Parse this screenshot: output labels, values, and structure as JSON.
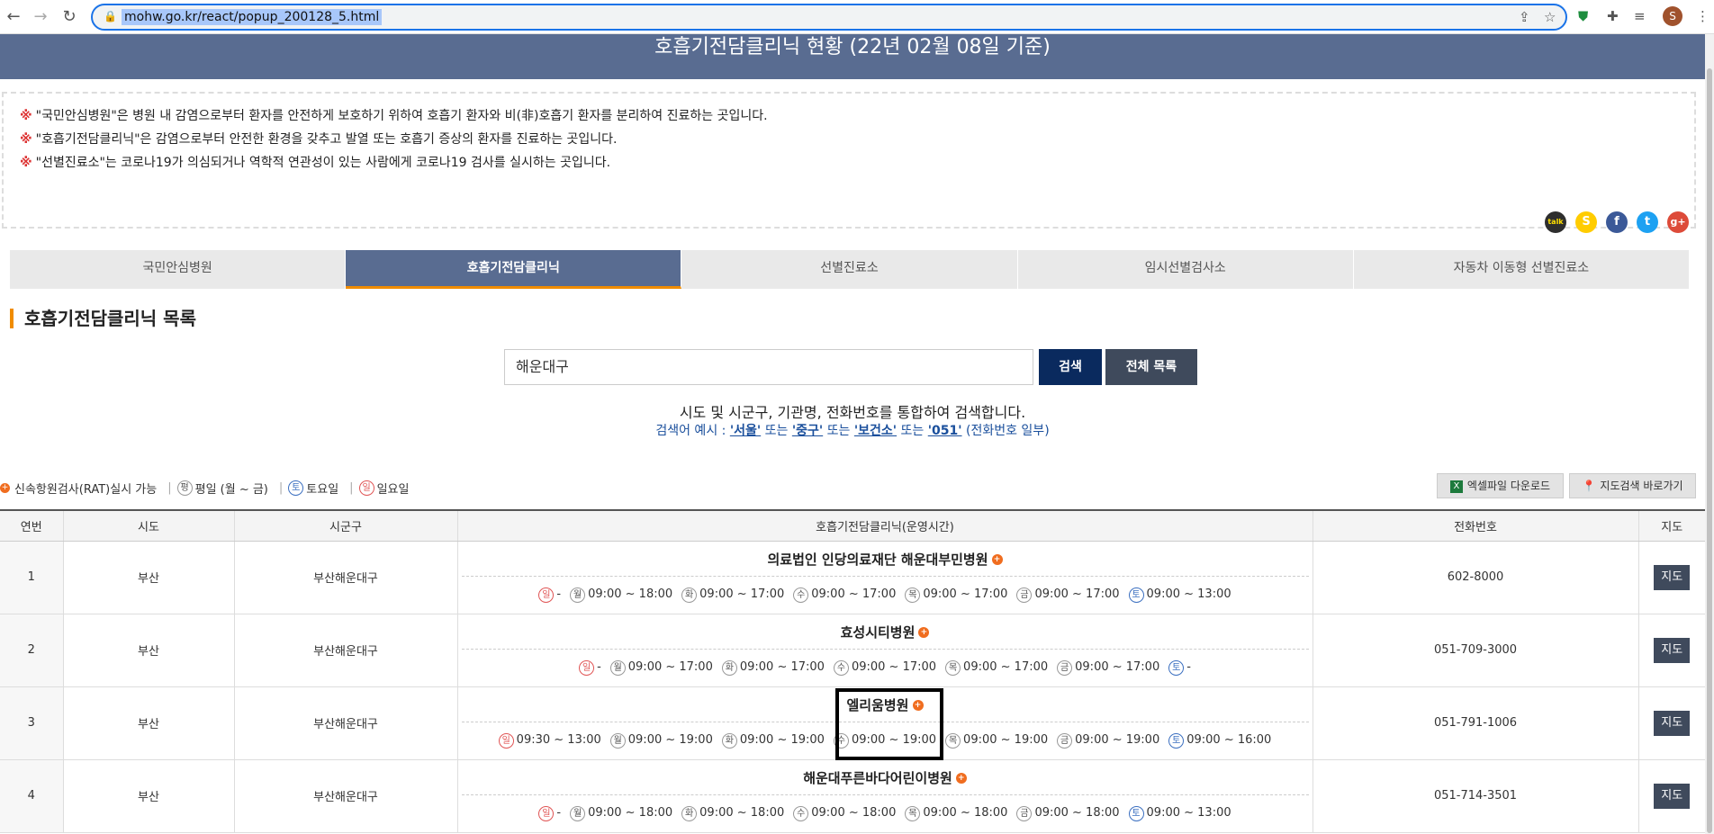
{
  "browser": {
    "url": "mohw.go.kr/react/popup_200128_5.html",
    "avatar_letter": "S",
    "icons": [
      "back-icon",
      "forward-icon",
      "reload-icon",
      "lock-icon",
      "share-icon",
      "star-icon",
      "shield-extension-icon",
      "puzzle-icon",
      "media-icon",
      "menu-icon"
    ]
  },
  "page": {
    "title": "호흡기전담클리닉 현황 (22년 02월 08일 기준)",
    "notices": [
      "\"국민안심병원\"은 병원 내 감염으로부터 환자를 안전하게 보호하기 위하여 호흡기 환자와 비(非)호흡기 환자를 분리하여 진료하는 곳입니다.",
      "\"호흡기전담클리닉\"은 감염으로부터 안전한 환경을 갖추고 발열 또는 호흡기 증상의 환자를 진료하는 곳입니다.",
      "\"선별진료소\"는 코로나19가 의심되거나 역학적 연관성이 있는 사람에게 코로나19 검사를 실시하는 곳입니다."
    ],
    "notice_mark": "※",
    "share": {
      "kakaotalk": "talk",
      "kakaostory": "S",
      "facebook": "f",
      "twitter": "t",
      "googleplus": "g+"
    },
    "tabs": [
      "국민안심병원",
      "호흡기전담클리닉",
      "선별진료소",
      "임시선별검사소",
      "자동차 이동형 선별진료소"
    ],
    "section_title": "호흡기전담클리닉 목록",
    "search": {
      "value": "해운대구",
      "search_label": "검색",
      "all_label": "전체 목록",
      "hint": "시도 및 시군구, 기관명, 전화번호를 통합하여 검색합니다.",
      "example_prefix": "검색어 예시 :",
      "examples": [
        "'서울'",
        "'중구'",
        "'보건소'",
        "'051'"
      ],
      "or": "또는",
      "example_suffix": "(전화번호 일부)"
    },
    "legend": {
      "rat": "신속항원검사(RAT)실시 가능",
      "weekday_mark": "평",
      "weekday": "평일 (월 ~ 금)",
      "sat_mark": "토",
      "sat": "토요일",
      "sun_mark": "일",
      "sun": "일요일"
    },
    "excel_label": "엑셀파일 다운로드",
    "map_label": "지도검색 바로가기",
    "table": {
      "headers": [
        "연번",
        "시도",
        "시군구",
        "호흡기전담클리닉(운영시간)",
        "전화번호",
        "지도"
      ],
      "map_button": "지도",
      "rows": [
        {
          "no": "1",
          "sido": "부산",
          "sigungu": "부산해운대구",
          "name": "의료법인 인당의료재단 해운대부민병원",
          "phone": "602-8000",
          "hours": [
            [
              "일",
              "-"
            ],
            [
              "월",
              "09:00 ~ 18:00"
            ],
            [
              "화",
              "09:00 ~ 17:00"
            ],
            [
              "수",
              "09:00 ~ 17:00"
            ],
            [
              "목",
              "09:00 ~ 17:00"
            ],
            [
              "금",
              "09:00 ~ 17:00"
            ],
            [
              "토",
              "09:00 ~ 13:00"
            ]
          ]
        },
        {
          "no": "2",
          "sido": "부산",
          "sigungu": "부산해운대구",
          "name": "효성시티병원",
          "phone": "051-709-3000",
          "hours": [
            [
              "일",
              "-"
            ],
            [
              "월",
              "09:00 ~ 17:00"
            ],
            [
              "화",
              "09:00 ~ 17:00"
            ],
            [
              "수",
              "09:00 ~ 17:00"
            ],
            [
              "목",
              "09:00 ~ 17:00"
            ],
            [
              "금",
              "09:00 ~ 17:00"
            ],
            [
              "토",
              "-"
            ]
          ]
        },
        {
          "no": "3",
          "sido": "부산",
          "sigungu": "부산해운대구",
          "name": "엘리움병원",
          "phone": "051-791-1006",
          "hours": [
            [
              "일",
              "09:30 ~ 13:00"
            ],
            [
              "월",
              "09:00 ~ 19:00"
            ],
            [
              "화",
              "09:00 ~ 19:00"
            ],
            [
              "수",
              "09:00 ~ 19:00"
            ],
            [
              "목",
              "09:00 ~ 19:00"
            ],
            [
              "금",
              "09:00 ~ 19:00"
            ],
            [
              "토",
              "09:00 ~ 16:00"
            ]
          ]
        },
        {
          "no": "4",
          "sido": "부산",
          "sigungu": "부산해운대구",
          "name": "해운대푸른바다어린이병원",
          "phone": "051-714-3501",
          "hours": [
            [
              "일",
              "-"
            ],
            [
              "월",
              "09:00 ~ 18:00"
            ],
            [
              "화",
              "09:00 ~ 18:00"
            ],
            [
              "수",
              "09:00 ~ 18:00"
            ],
            [
              "목",
              "09:00 ~ 18:00"
            ],
            [
              "금",
              "09:00 ~ 18:00"
            ],
            [
              "토",
              "09:00 ~ 13:00"
            ]
          ]
        }
      ]
    }
  }
}
